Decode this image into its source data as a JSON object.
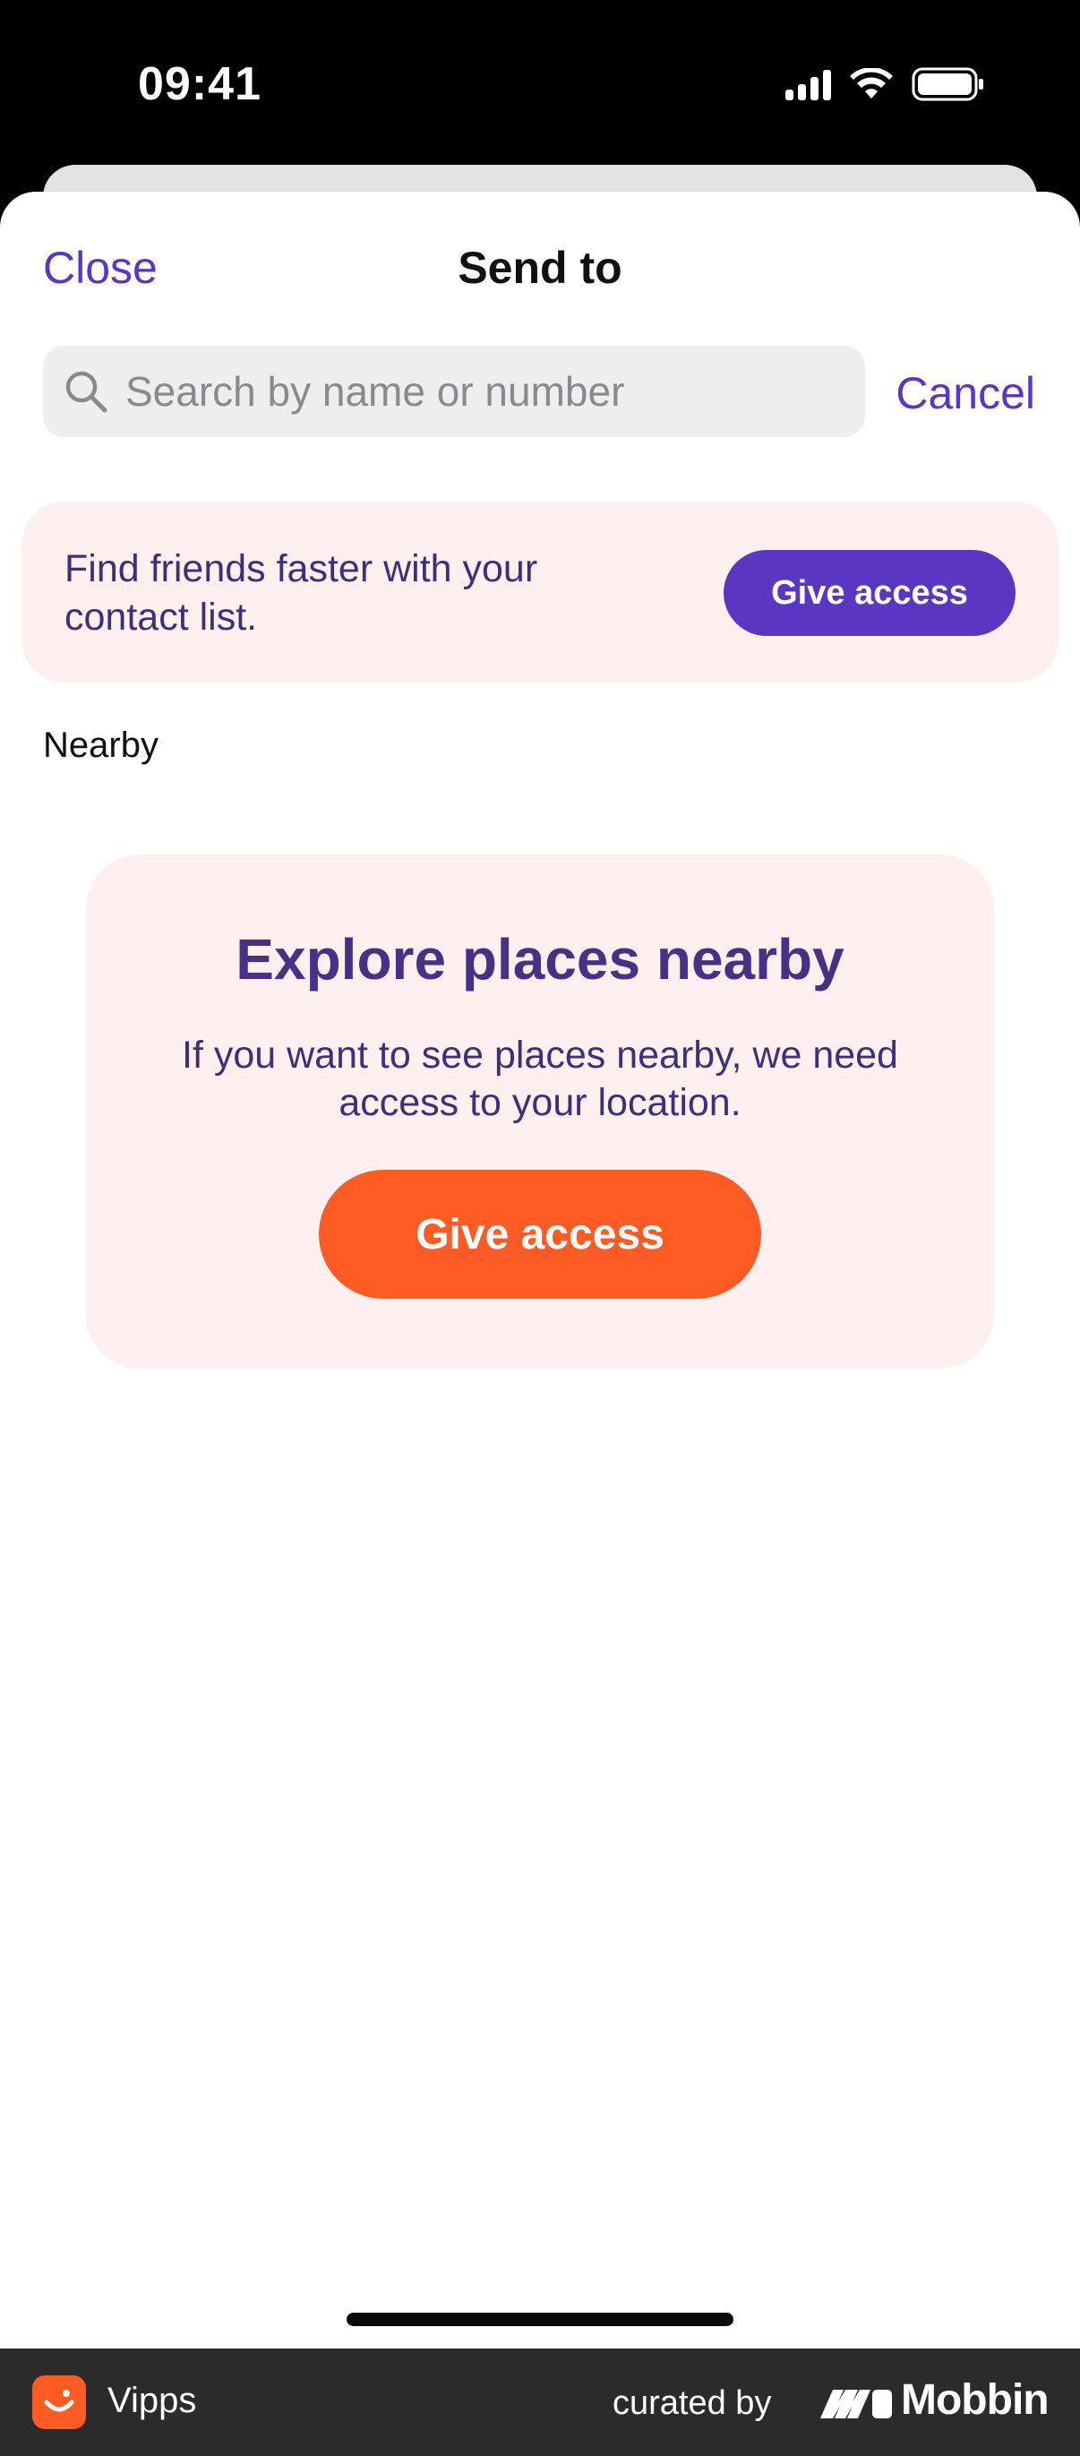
{
  "status_bar": {
    "time": "09:41"
  },
  "nav": {
    "close": "Close",
    "title": "Send to"
  },
  "search": {
    "placeholder": "Search by name or number",
    "cancel": "Cancel"
  },
  "contacts_banner": {
    "text": "Find friends faster with your contact list.",
    "button": "Give access"
  },
  "nearby": {
    "label": "Nearby",
    "card_title": "Explore places nearby",
    "card_text": "If you want to see places nearby, we need access to your location.",
    "button": "Give access"
  },
  "footer": {
    "app_name": "Vipps",
    "curated_by": "curated by",
    "brand": "Mobbin"
  },
  "colors": {
    "accent_purple": "#5a36c2",
    "brand_orange": "#ff5b24",
    "banner_bg": "#fdf0ef",
    "heading_purple": "#4a2f86"
  }
}
